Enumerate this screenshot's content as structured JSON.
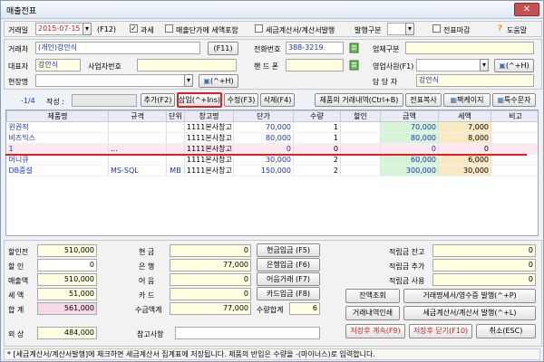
{
  "window": {
    "title": "매출전표",
    "close": "✕"
  },
  "top": {
    "date_label": "거래일",
    "date": "2015-07-15",
    "f12": "(F12)",
    "tax_check": "✓",
    "tax_label": "과세",
    "vat_check_label": "매출단가에 세액포함",
    "invoice_label": "세금계산서/계산서발행",
    "issue_type_label": "발행구분",
    "close_label": "전표마감",
    "help_label": "도움말"
  },
  "form": {
    "client_label": "거래처",
    "client": "(개인)강안식",
    "f11": "(F11)",
    "phone_label": "전화번호",
    "phone": "388-3219",
    "biztype_label": "업체구분",
    "rep_label": "대표자",
    "rep": "강안식",
    "bizno_label": "사업자번호",
    "hp_label": "핸 드 폰",
    "sales_label": "영업사원(F1)",
    "ctrlh": "(^+H)",
    "site_label": "현장명",
    "manager_label": "담 당 자",
    "manager": "강안식"
  },
  "toolbar": {
    "count": "-1/4",
    "writer_label": "작성 :",
    "add": "추가(F2)",
    "insert": "삽입(^+Ins)",
    "edit": "수정(F3)",
    "delete": "삭제(F4)",
    "history": "제품의 거래내역(Ctrl+B)",
    "copy": "전표복사",
    "page": "팩케이지",
    "special": "특수문자"
  },
  "grid": {
    "headers": [
      "제품명",
      "규격",
      "단위",
      "창고명",
      "단가",
      "수량",
      "할인",
      "금액",
      "세액",
      "비고"
    ],
    "rows": [
      {
        "name": "윈권적",
        "spec": "",
        "unit": "",
        "wh": "1111본사창고",
        "price": "70,000",
        "qty": "1",
        "disc": "",
        "amt": "70,000",
        "tax": "7,000",
        "note": ""
      },
      {
        "name": "비즈믹스",
        "spec": "",
        "unit": "",
        "wh": "1111본사창고",
        "price": "80,000",
        "qty": "1",
        "disc": "",
        "amt": "80,000",
        "tax": "8,000",
        "note": ""
      },
      {
        "name": "1",
        "spec": "…",
        "unit": "",
        "wh": "1111본사창고",
        "price": "0",
        "qty": "0",
        "disc": "",
        "amt": "0",
        "tax": "0",
        "note": ""
      },
      {
        "name": "머니큐",
        "spec": "",
        "unit": "",
        "wh": "1111본사창고",
        "price": "30,000",
        "qty": "2",
        "disc": "",
        "amt": "60,000",
        "tax": "6,000",
        "note": ""
      },
      {
        "name": "DB중설",
        "spec": "MS-SQL",
        "unit": "MB",
        "wh": "1111본사창고",
        "price": "150,000",
        "qty": "2",
        "disc": "",
        "amt": "300,000",
        "tax": "30,000",
        "note": ""
      }
    ]
  },
  "summary": {
    "pre_disc_label": "할인전",
    "pre_disc": "510,000",
    "disc_label": "할 인",
    "disc": "0",
    "sales_label": "매출액",
    "sales": "510,000",
    "tax_label": "세 액",
    "tax": "51,000",
    "total_label": "합 계",
    "total": "561,000",
    "credit_label": "외 상",
    "credit": "484,000",
    "cash_label": "현 금",
    "cash": "0",
    "bank_label": "은 행",
    "bank": "77,000",
    "bill_label": "어 음",
    "bill": "0",
    "card_label": "카 드",
    "card": "0",
    "collect_label": "수금액계",
    "collect": "77,000",
    "qty_total_label": "수량합계",
    "qty_total": "6",
    "ref_label": "참고사항",
    "cash_btn": "현금입금 (F5)",
    "bank_btn": "은행입금 (F6)",
    "bill_btn": "어음거래 (F7)",
    "card_btn": "카드입금 (F8)",
    "point_bal_label": "적립금 잔고",
    "point_bal": "0",
    "point_add_label": "적립금 추가",
    "point_add": "0",
    "point_use_label": "적립금 사용",
    "point_use": "0",
    "balance_btn": "잔액조회",
    "stmt_btn": "거래명세서/영수증 발행(^+P)",
    "hist_print_btn": "거래내역인쇄",
    "tax_inv_btn": "세금계산서/계산서 발행(^+L)",
    "save_cont_btn": "저장후 계속(F9)",
    "save_close_btn": "저장후 닫기(F10)",
    "cancel_btn": "취소(ESC)"
  },
  "status": "* [세금계산서/계산서발행]에 체크하면 세금계산서 집계표에 저장됩니다.   제품의 반입은 수량을 -(마이너스)로 입력합니다."
}
